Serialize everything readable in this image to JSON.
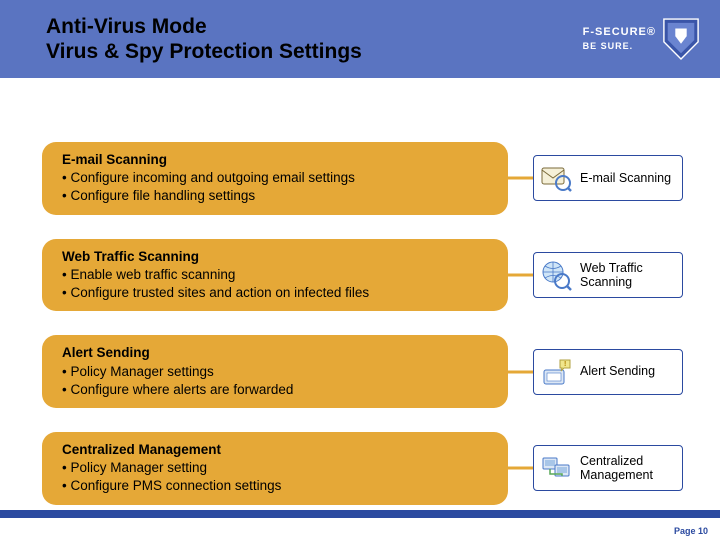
{
  "brand": {
    "name": "F-SECURE",
    "registered": "®",
    "tagline": "BE SURE."
  },
  "header": {
    "title_line1": "Anti-Virus Mode",
    "title_line2": "Virus & Spy Protection Settings"
  },
  "sections": [
    {
      "heading": "E-mail Scanning",
      "bullets": [
        "Configure incoming and outgoing email settings",
        "Configure file handling settings"
      ],
      "panel_label": "E-mail Scanning",
      "has_panel": true,
      "icon": "email-scan-icon"
    },
    {
      "heading": "Web Traffic Scanning",
      "bullets": [
        "Enable web traffic scanning",
        "Configure trusted sites and action on infected files"
      ],
      "panel_label": "Web Traffic Scanning",
      "has_panel": true,
      "icon": "web-scan-icon"
    },
    {
      "heading": "Alert Sending",
      "bullets": [
        "Policy Manager settings",
        "Configure where alerts are forwarded"
      ],
      "panel_label": "Alert Sending",
      "has_panel": true,
      "icon": "alert-icon"
    },
    {
      "heading": "Centralized Management",
      "bullets": [
        "Policy Manager setting",
        "Configure PMS connection settings"
      ],
      "panel_label": "Centralized Management",
      "has_panel": true,
      "icon": "central-mgmt-icon"
    }
  ],
  "footer": {
    "page_label": "Page 10"
  }
}
